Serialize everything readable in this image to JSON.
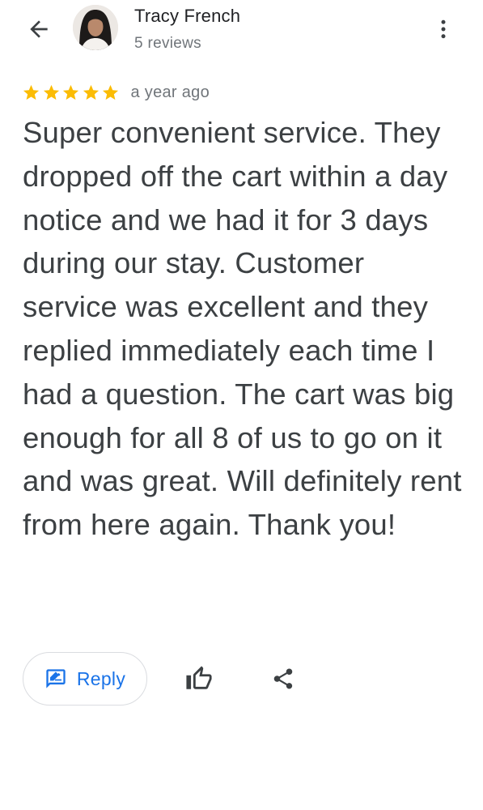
{
  "header": {
    "back_icon": "arrow-back-icon",
    "author_name": "Tracy French",
    "author_reviews": "5 reviews",
    "more_icon": "more-vert-icon"
  },
  "review": {
    "rating": 5,
    "rating_max": 5,
    "star_color": "#fbbc04",
    "date": "a year ago",
    "text": "Super convenient service. They dropped off the cart within a day notice and we had it for 3 days during our stay. Customer service was excellent and they replied immediately each time I had a question. The cart was big enough for all 8 of us to go on it and was great. Will definitely rent from here again. Thank you!"
  },
  "actions": {
    "reply_label": "Reply",
    "reply_icon": "rate-review-icon",
    "like_icon": "thumb-up-icon",
    "share_icon": "share-icon",
    "accent_color": "#1a73e8"
  }
}
